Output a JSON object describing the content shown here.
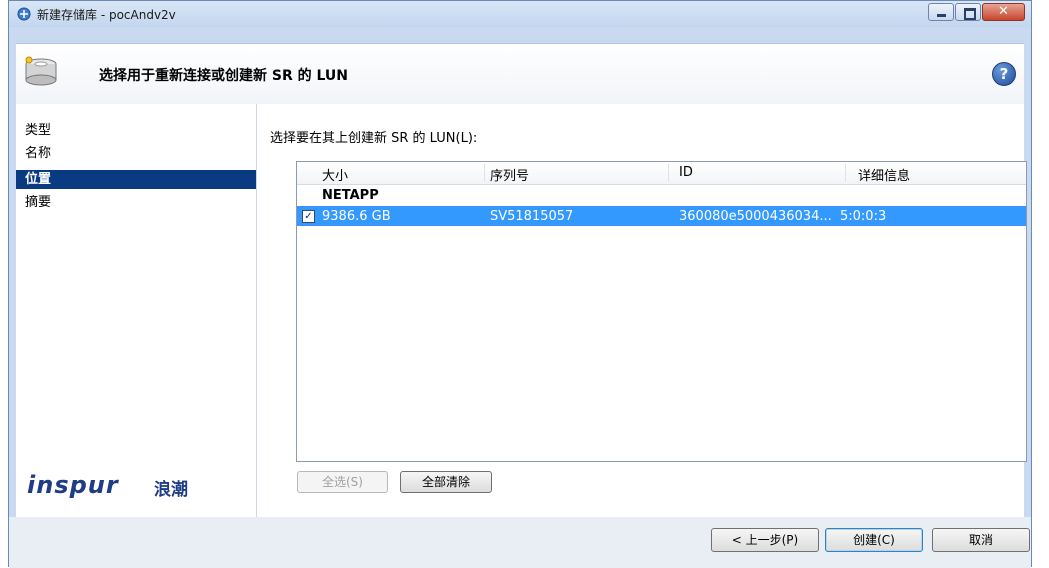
{
  "window": {
    "title": "新建存储库 - pocAndv2v",
    "controls": {
      "minimize": "minimize-icon",
      "maximize": "maximize-icon",
      "close": "close-icon"
    }
  },
  "header": {
    "title": "选择用于重新连接或创建新 SR 的 LUN",
    "help_icon": "?"
  },
  "sidebar": {
    "items": [
      {
        "label": "类型",
        "selected": false
      },
      {
        "label": "名称",
        "selected": false
      },
      {
        "label": "位置",
        "selected": true
      },
      {
        "label": "摘要",
        "selected": false
      }
    ],
    "logo_text": "inspur",
    "logo_cn": "浪潮"
  },
  "main": {
    "instruction": "选择要在其上创建新 SR 的 LUN(L):",
    "table": {
      "columns": [
        "大小",
        "序列号",
        "ID",
        "详细信息"
      ],
      "groups": [
        {
          "name": "NETAPP",
          "rows": [
            {
              "checked": true,
              "size": "9386.6 GB",
              "serial": "SV51815057",
              "id": "360080e5000436034...",
              "details": "5:0:0:3"
            }
          ]
        }
      ]
    },
    "select_all_label": "全选(S)",
    "clear_all_label": "全部清除"
  },
  "footer": {
    "back_label": "< 上一步(P)",
    "create_label": "创建(C)",
    "cancel_label": "取消"
  },
  "colors": {
    "selection": "#3399ff",
    "nav_selected": "#0a3a82",
    "brand": "#1f3c85"
  }
}
